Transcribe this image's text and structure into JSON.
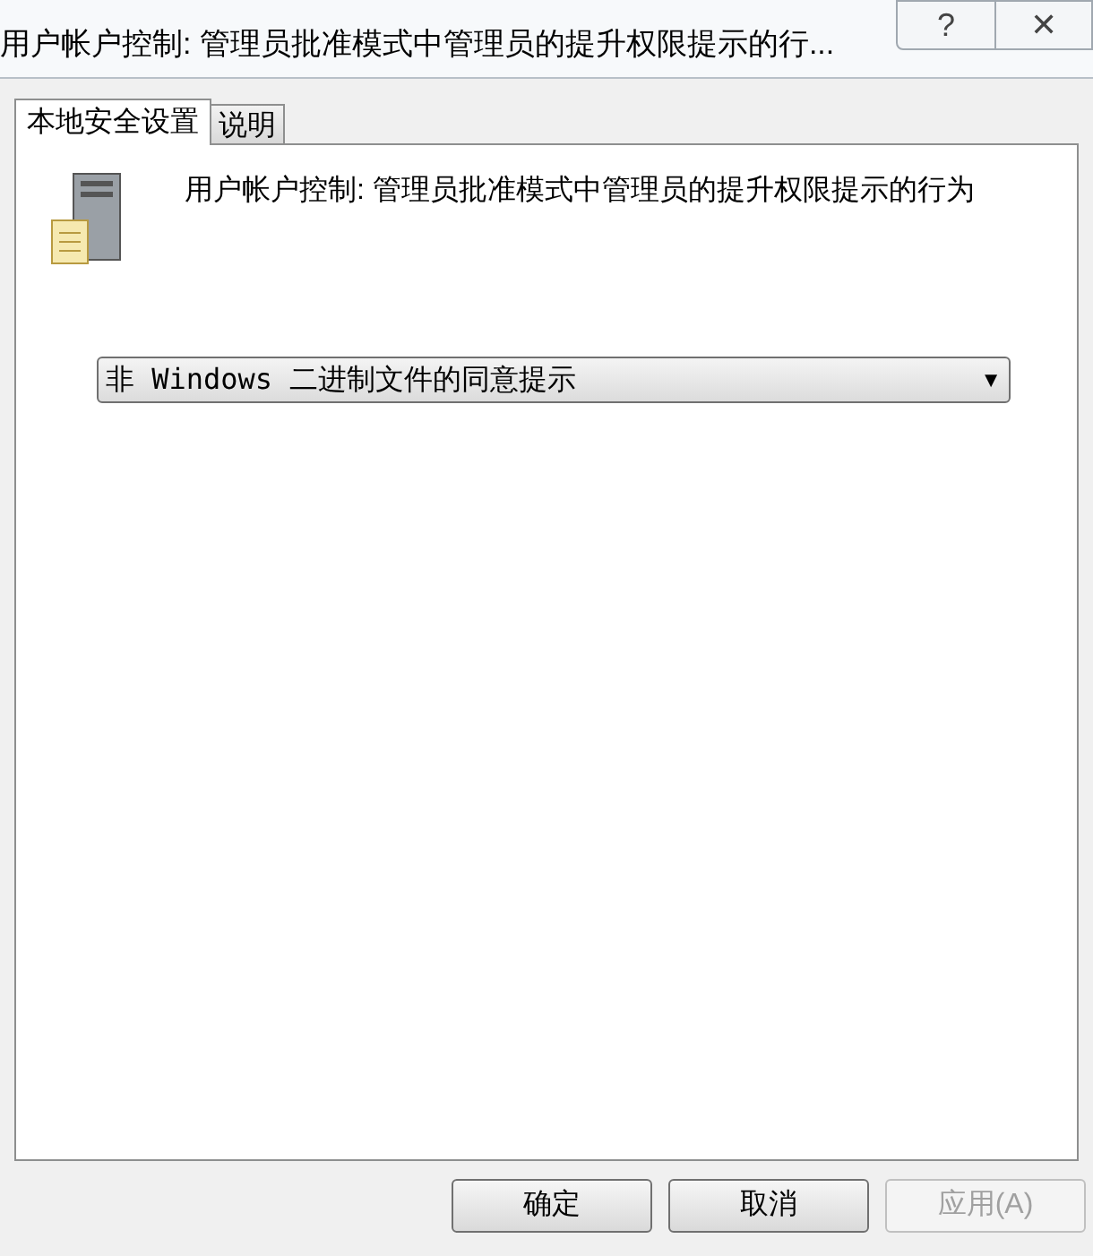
{
  "window": {
    "title": "用户帐户控制: 管理员批准模式中管理员的提升权限提示的行...",
    "help_button": "?",
    "close_button": "✕"
  },
  "tabs": [
    {
      "label": "本地安全设置",
      "selected": true
    },
    {
      "label": "说明",
      "selected": false
    }
  ],
  "policy": {
    "name": "用户帐户控制: 管理员批准模式中管理员的提升权限提示的行为"
  },
  "dropdown": {
    "value": "非 Windows 二进制文件的同意提示",
    "arrow": "▼"
  },
  "buttons": [
    {
      "label": "确定",
      "disabled": false
    },
    {
      "label": "取消",
      "disabled": false
    },
    {
      "label": "应用(A)",
      "disabled": true
    }
  ]
}
